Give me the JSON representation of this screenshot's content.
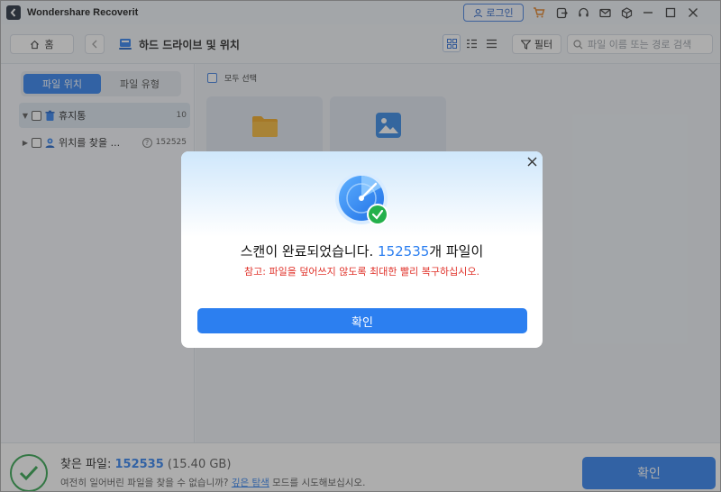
{
  "app": {
    "title": "Wondershare Recoverit"
  },
  "titlebar": {
    "login_label": "로그인",
    "icons": [
      "cart-icon",
      "export-icon",
      "headset-icon",
      "mail-icon",
      "cube-icon",
      "minimize-icon",
      "maximize-icon",
      "close-icon"
    ]
  },
  "navbar": {
    "home_label": "홈",
    "location_title": "하드 드라이브 및 위치",
    "filter_label": "필터",
    "search_placeholder": "파일 이름 또는 경로 검색"
  },
  "sidebar": {
    "tabs": [
      {
        "label": "파일 위치",
        "active": true
      },
      {
        "label": "파일 유형",
        "active": false
      }
    ],
    "items": [
      {
        "label": "휴지통",
        "count": "10",
        "expanded": true,
        "selected": true
      },
      {
        "label": "위치를 찾을 ...",
        "count": "152525",
        "expanded": false,
        "selected": false
      }
    ]
  },
  "main": {
    "select_all_label": "모두 선택"
  },
  "modal": {
    "heading_prefix": "스캔이 완료되었습니다. ",
    "heading_count": "152535",
    "heading_suffix": "개 파일이",
    "note": "참고: 파일을 덮어쓰지 않도록 최대한 빨리 복구하십시오.",
    "confirm_label": "확인"
  },
  "footer": {
    "found_label": "찾은 파일: ",
    "found_count": "152535",
    "found_size": "(15.40 GB)",
    "hint_prefix": "여전히 일어버린 파일을 찾을 수 없습니까? ",
    "hint_link": "깊은 탐색",
    "hint_suffix": " 모드를 시도해보십시오.",
    "confirm_label": "확인"
  },
  "colors": {
    "accent": "#2c7ff0",
    "warning": "#e0332b",
    "success": "#2da24a"
  }
}
